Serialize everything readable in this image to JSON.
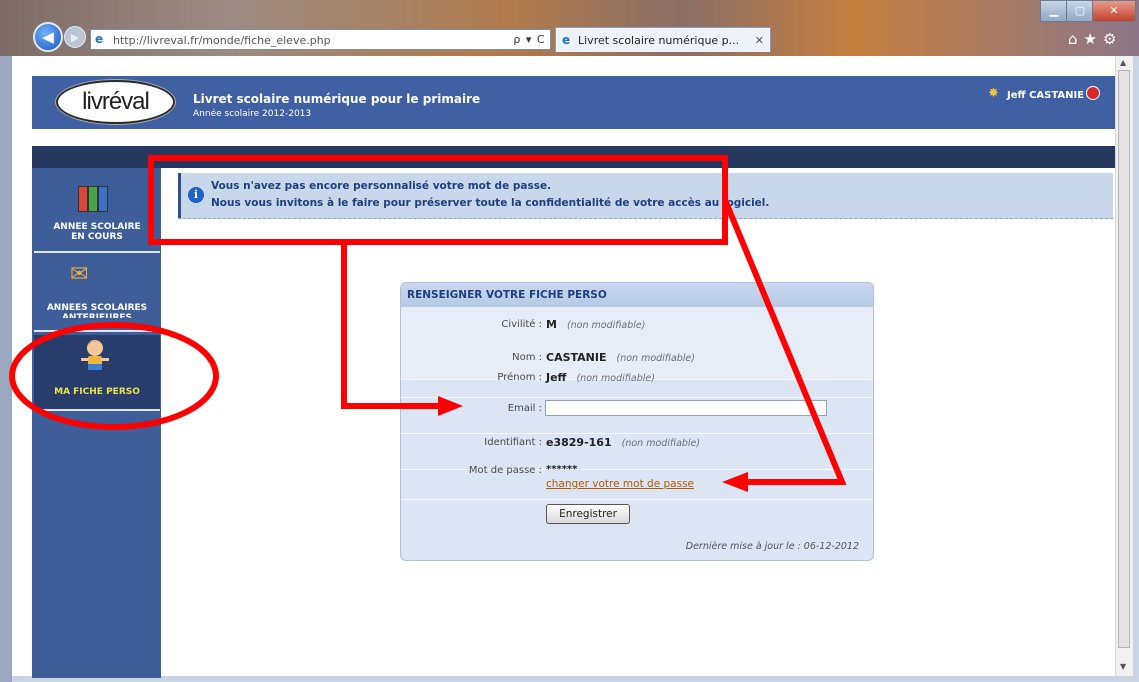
{
  "browser": {
    "url": "http://livreval.fr/monde/fiche_eleve.php",
    "address_controls": "ρ ▾ C ✕",
    "tab_title": "Livret scolaire numérique p...",
    "tab_close": "✕",
    "window_controls": {
      "minimize": "▁",
      "maximize": "▢",
      "close": "✕"
    },
    "toolbar_icons": "⌂★⚙"
  },
  "header": {
    "logo_text": "livréval",
    "title": "Livret scolaire numérique pour le primaire",
    "subtitle": "Année scolaire 2012-2013",
    "user": "Jeff CASTANIE",
    "bg_color": "#3f61a3"
  },
  "sidebar": {
    "items": [
      {
        "label_line1": "ANNEE SCOLAIRE",
        "label_line2": "EN COURS",
        "icon": "books-icon"
      },
      {
        "label_line1": "ANNEES SCOLAIRES",
        "label_line2": "ANTERIEURES",
        "icon": "documents-icon"
      },
      {
        "label_line1": "MA FICHE PERSO",
        "label_line2": "",
        "icon": "child-icon",
        "active": true
      }
    ]
  },
  "notice": {
    "line1": "Vous n'avez pas encore personnalisé votre mot de passe.",
    "line2": "Nous vous invitons à le faire pour préserver toute la confidentialité de votre accès au logiciel."
  },
  "form": {
    "title": "RENSEIGNER VOTRE FICHE PERSO",
    "civilite": {
      "label": "Civilité :",
      "value": "M",
      "note": "(non modifiable)"
    },
    "nom": {
      "label": "Nom :",
      "value": "CASTANIE",
      "note": "(non modifiable)"
    },
    "prenom": {
      "label": "Prénom :",
      "value": "Jeff",
      "note": "(non modifiable)"
    },
    "email": {
      "label": "Email :",
      "value": ""
    },
    "identifiant": {
      "label": "Identifiant :",
      "value": "e3829-161",
      "note": "(non modifiable)"
    },
    "password": {
      "label": "Mot de passe :",
      "value": "******",
      "link": "changer votre mot de passe"
    },
    "save_label": "Enregistrer",
    "last_update": "Dernière mise à jour le : 06-12-2012"
  },
  "annotation_color": "#ff0000"
}
